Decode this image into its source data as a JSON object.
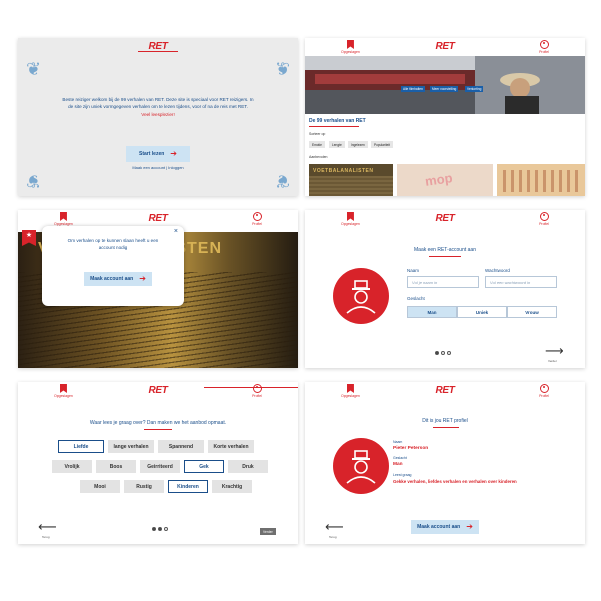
{
  "brand": {
    "logo": "RET",
    "accent": "#d8232a",
    "primary": "#1a4e8a",
    "button_bg": "#cde3f3"
  },
  "nav": {
    "saved_label": "Opgeslagen",
    "profile_label": "Profiel"
  },
  "screen1": {
    "welcome_line1": "Beste reiziger welkom bij de 99 verhalen van RET. Deze site is speciaal voor RET reizigers. In",
    "welcome_line2": "de site zijn uniek vormgegeven verhalen om te lezen tijdens, voor of na de reis met RET.",
    "welcome_line3": "Veel leesplezier!",
    "start_button": "Start lezen",
    "account_link": "Maak een account | Inloggen"
  },
  "screen2": {
    "hero_chips": [
      "Alle filmhalten",
      "Meer voorstelling",
      "Verkorting"
    ],
    "title": "De 99 verhalen van RET",
    "tags_label": "Sorteer op",
    "tags": [
      "Emotie",
      "Lengte",
      "Ingelezen",
      "Populariteit"
    ],
    "section_label": "Aanbevolen",
    "thumb_labels": [
      "VOETBALANALISTEN",
      "mop",
      ""
    ]
  },
  "screen3": {
    "book_title": "VOETBALANALISTEN",
    "popup_text_line1": "Om verhalen op te kunnen slaan heeft u een",
    "popup_text_line2": "account nodig",
    "popup_button": "Maak account aan",
    "close_icon": "×",
    "star_icon": "★"
  },
  "screen4": {
    "title": "Maak een RET-account aan",
    "name_label": "Naam",
    "name_placeholder": "Vul je naam in",
    "password_label": "Wachtwoord",
    "password_placeholder": "Vul een wachtwoord in",
    "gender_label": "Geslacht",
    "gender_options": [
      "Man",
      "Uniek",
      "Vrouw"
    ],
    "gender_selected": "Man",
    "next_caption": "Verder"
  },
  "screen5": {
    "title": "Waar lees je graag over? Dan maken we het aanbod opmaat.",
    "chips_row1": [
      "Liefde",
      "lange verhalen",
      "Spannend",
      "Korte verhalen"
    ],
    "chips_row2": [
      "Vrolijk",
      "Boos",
      "Geirriteerd",
      "Gek",
      "Druk"
    ],
    "chips_row3": [
      "Mooi",
      "Rustig",
      "Kinderen",
      "Krachtig"
    ],
    "selected": [
      "Liefde",
      "Gek",
      "Kinderen"
    ],
    "back_caption": "Terug",
    "skip_button": "Verder"
  },
  "screen6": {
    "title": "Dit is jou RET profiel",
    "name_label": "Naam",
    "name_value": "Pieter Peterson",
    "gender_label": "Geslacht",
    "gender_value": "Man",
    "reads_label": "Leest graag",
    "reads_value": "Gekke verhalen, liefdes verhalen en verhalen over kinderen",
    "button": "Maak account aan",
    "back_caption": "Terug"
  }
}
